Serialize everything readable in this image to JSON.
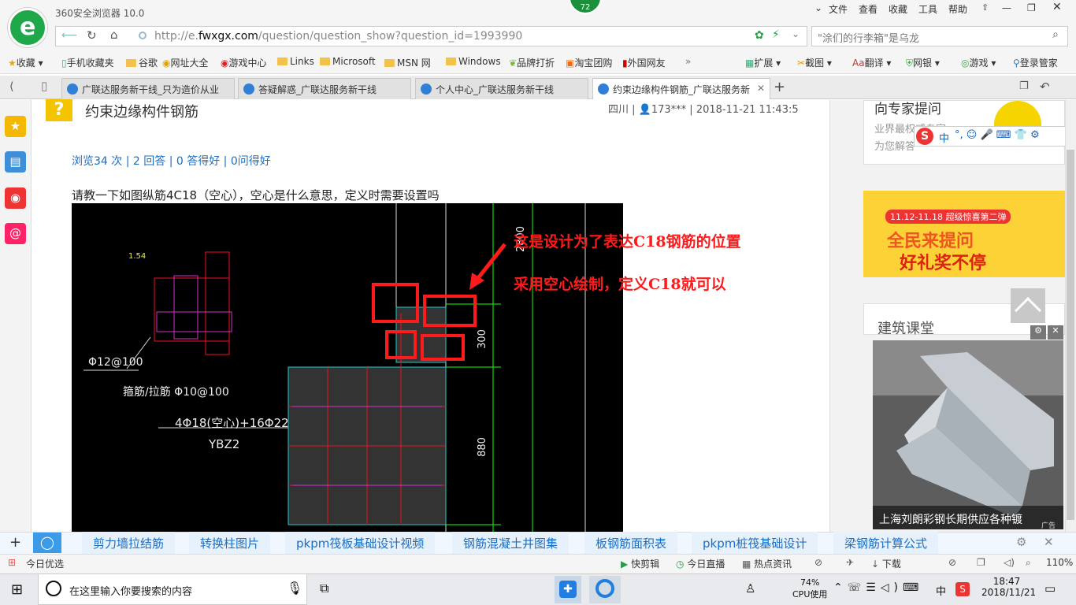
{
  "window": {
    "app_title": "360安全浏览器 10.0",
    "badge": "72"
  },
  "menu": [
    "文件",
    "查看",
    "收藏",
    "工具",
    "帮助"
  ],
  "address": {
    "url_prefix": "http://e.",
    "url_domain": "fwxgx.com",
    "url_path": "/question/question_show?question_id=1993990",
    "search_placeholder": "\"涂们的行李箱\"是乌龙"
  },
  "favorites": [
    {
      "label": "收藏",
      "icon": "star-icon"
    },
    {
      "label": "手机收藏夹",
      "icon": "phone-icon"
    },
    {
      "label": "谷歌",
      "icon": "folder-icon"
    },
    {
      "label": "网址大全",
      "icon": "globe-icon"
    },
    {
      "label": "游戏中心",
      "icon": "game-icon"
    },
    {
      "label": "Links",
      "icon": "folder-icon"
    },
    {
      "label": "Microsoft",
      "icon": "folder-icon"
    },
    {
      "label": "MSN 网",
      "icon": "folder-icon"
    },
    {
      "label": "Windows",
      "icon": "folder-icon"
    },
    {
      "label": "品牌打折",
      "icon": "leaf-icon"
    },
    {
      "label": "淘宝团购",
      "icon": "taobao-icon"
    },
    {
      "label": "外国网友",
      "icon": "flag-icon"
    }
  ],
  "toolbar_right": [
    "扩展",
    "截图",
    "翻译",
    "网银",
    "游戏",
    "登录管家"
  ],
  "tabs": [
    {
      "label": "广联达服务新干线_只为造价从业",
      "active": false
    },
    {
      "label": "答疑解惑_广联达服务新干线",
      "active": false
    },
    {
      "label": "个人中心_广联达服务新干线",
      "active": false
    },
    {
      "label": "约束边缘构件钢筋_广联达服务新",
      "active": true
    }
  ],
  "question": {
    "title": "约束边缘构件钢筋",
    "meta": "四川 | ",
    "user": "173***",
    "time": " | 2018-11-21 11:43:5",
    "stats": "浏览34 次 | 2 回答 | 0 答得好 | 0问得好",
    "body": "请教一下如图纵筋4C18（空心），空心是什么意思，定义时需要设置吗"
  },
  "cad": {
    "label_154": "1.54",
    "label_phi12": "Φ12@100",
    "label_tie": "箍筋/拉筋 Φ10@100",
    "label_rebar": "4Φ18(空心)+16Φ22",
    "label_ybz": "YBZ2",
    "dim_2800": "2800",
    "dim_300": "300",
    "dim_880": "880",
    "annotation_line1": "这是设计为了表达C18钢筋的位置",
    "annotation_line2": "采用空心绘制，定义C18就可以"
  },
  "sidebar_right": {
    "expert_title": "向专家提问",
    "expert_sub1": "业界最权威专家",
    "expert_sub2": "为您解答",
    "ad_banner_line1": "11.12-11.18  超级惊喜第二弹",
    "ad_banner_line2": "全民来提问",
    "ad_banner_line3": "好礼奖不停",
    "course_title": "建筑课堂",
    "ad_caption": "上海刘朗彩钢长期供应各种镀",
    "ad_tag": "广告"
  },
  "ime": {
    "label": "中"
  },
  "keywords": [
    "剪力墙拉结筋",
    "转换柱图片",
    "pkpm筏板基础设计视频",
    "钢筋混凝土井图集",
    "板钢筋面积表",
    "pkpm桩筏基础设计",
    "梁钢筋计算公式"
  ],
  "statusbar": {
    "left": "今日优选",
    "items": [
      "快剪辑",
      "今日直播",
      "热点资讯",
      "下载"
    ],
    "zoom": "110%"
  },
  "taskbar": {
    "search_placeholder": "在这里输入你要搜索的内容",
    "cpu_percent": "74%",
    "cpu_label": "CPU使用",
    "ime": "中",
    "time": "18:47",
    "date": "2018/11/21"
  }
}
